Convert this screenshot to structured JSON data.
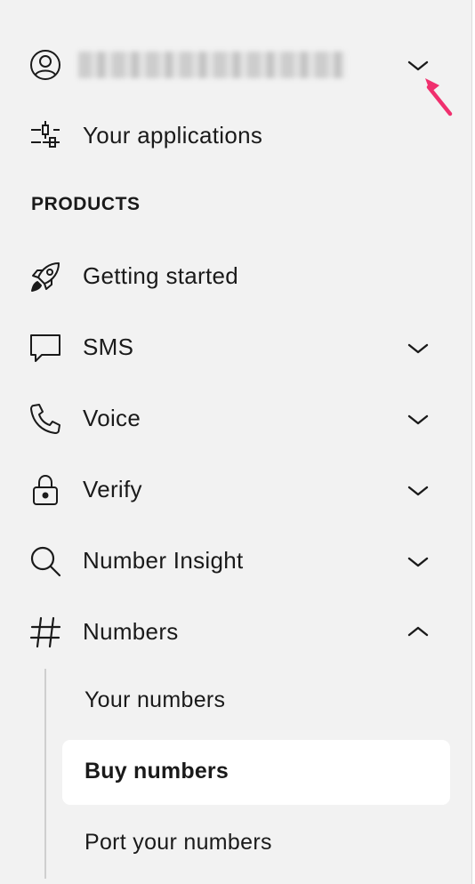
{
  "account": {
    "name_redacted": "",
    "icon": "user-circle-icon",
    "expand_icon": "chevron-down-icon"
  },
  "nav_top": {
    "applications_label": "Your applications",
    "applications_icon": "sliders-icon"
  },
  "products": {
    "section_title": "PRODUCTS",
    "items": [
      {
        "label": "Getting started",
        "icon": "rocket-icon"
      },
      {
        "label": "SMS",
        "icon": "chat-bubble-icon",
        "expand": "chevron-down-icon"
      },
      {
        "label": "Voice",
        "icon": "phone-icon",
        "expand": "chevron-down-icon"
      },
      {
        "label": "Verify",
        "icon": "lock-icon",
        "expand": "chevron-down-icon"
      },
      {
        "label": "Number Insight",
        "icon": "search-icon",
        "expand": "chevron-down-icon"
      },
      {
        "label": "Numbers",
        "icon": "hash-icon",
        "expand": "chevron-up-icon"
      }
    ]
  },
  "numbers_submenu": {
    "items": [
      {
        "label": "Your numbers"
      },
      {
        "label": "Buy numbers",
        "active": true
      },
      {
        "label": "Port your numbers"
      }
    ]
  },
  "annotation": {
    "arrow_color": "#f0306e"
  }
}
